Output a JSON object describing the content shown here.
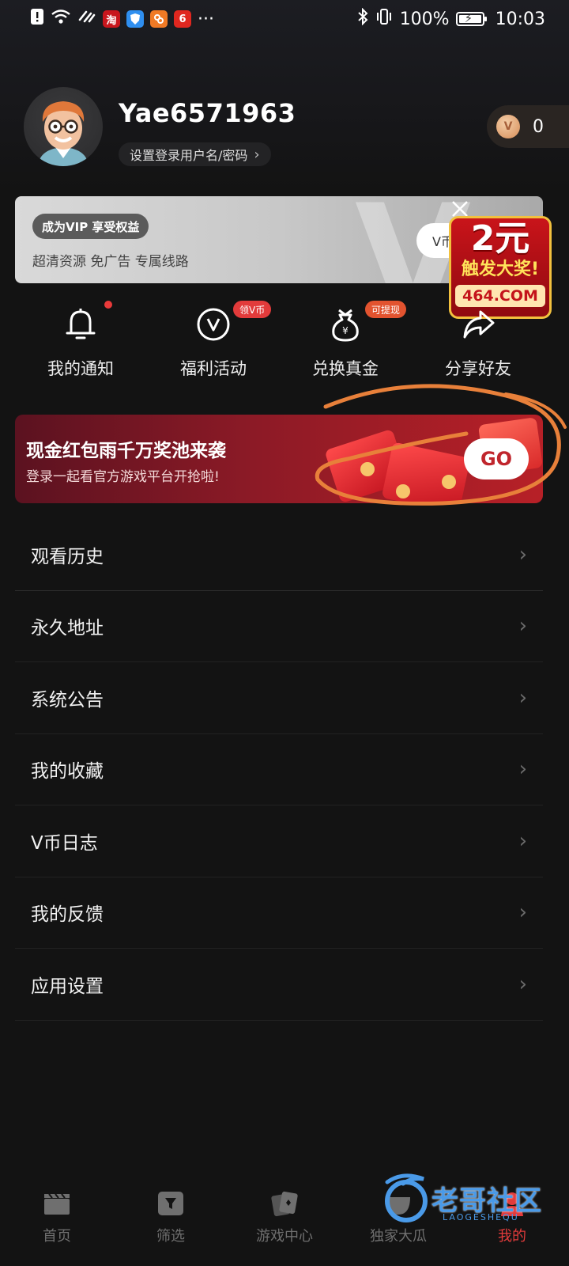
{
  "status_bar": {
    "app_icons": [
      "alert-icon",
      "wifi-icon",
      "link-icon",
      "taobao-icon",
      "shield-icon",
      "app-orange-icon",
      "netease-icon"
    ],
    "app_glyphs": [
      "淘",
      "",
      "",
      "6"
    ],
    "more": "···",
    "battery_percent": "100%",
    "time": "10:03"
  },
  "profile": {
    "username": "Yae6571963",
    "login_link": "设置登录用户名/密码",
    "coin_symbol": "V",
    "coin_count": "0"
  },
  "vip_banner": {
    "tag": "成为VIP 享受权益",
    "perks": "超清资源  免广告  专属线路",
    "button": "V币",
    "watermark": "V"
  },
  "ad_float": {
    "line1": "2元",
    "line2": "触发大奖!",
    "line3": "464.COM"
  },
  "quick_actions": [
    {
      "label": "我的通知",
      "icon": "bell-icon",
      "badge": ""
    },
    {
      "label": "福利活动",
      "icon": "v-coin-icon",
      "badge": "领V币"
    },
    {
      "label": "兑换真金",
      "icon": "money-bag-icon",
      "badge": "可提现"
    },
    {
      "label": "分享好友",
      "icon": "share-icon",
      "badge": ""
    }
  ],
  "promo_banner": {
    "title": "现金红包雨千万奖池来袭",
    "subtitle": "登录一起看官方游戏平台开抢啦!",
    "button": "GO"
  },
  "menu": [
    {
      "label": "观看历史"
    },
    {
      "label": "永久地址"
    },
    {
      "label": "系统公告"
    },
    {
      "label": "我的收藏"
    },
    {
      "label": "V币日志"
    },
    {
      "label": "我的反馈"
    },
    {
      "label": "应用设置"
    }
  ],
  "tabs": [
    {
      "label": "首页",
      "icon": "clapperboard-icon"
    },
    {
      "label": "筛选",
      "icon": "filter-icon"
    },
    {
      "label": "游戏中心",
      "icon": "cards-icon"
    },
    {
      "label": "独家大瓜",
      "icon": "melon-icon"
    },
    {
      "label": "我的",
      "icon": "user-icon",
      "active": true
    }
  ],
  "watermark": {
    "text": "老哥社区",
    "sub": "LAOGESHEQU"
  },
  "colors": {
    "background": "#131313",
    "accent_red": "#e33b3b",
    "annotation_orange": "#e8803a"
  }
}
